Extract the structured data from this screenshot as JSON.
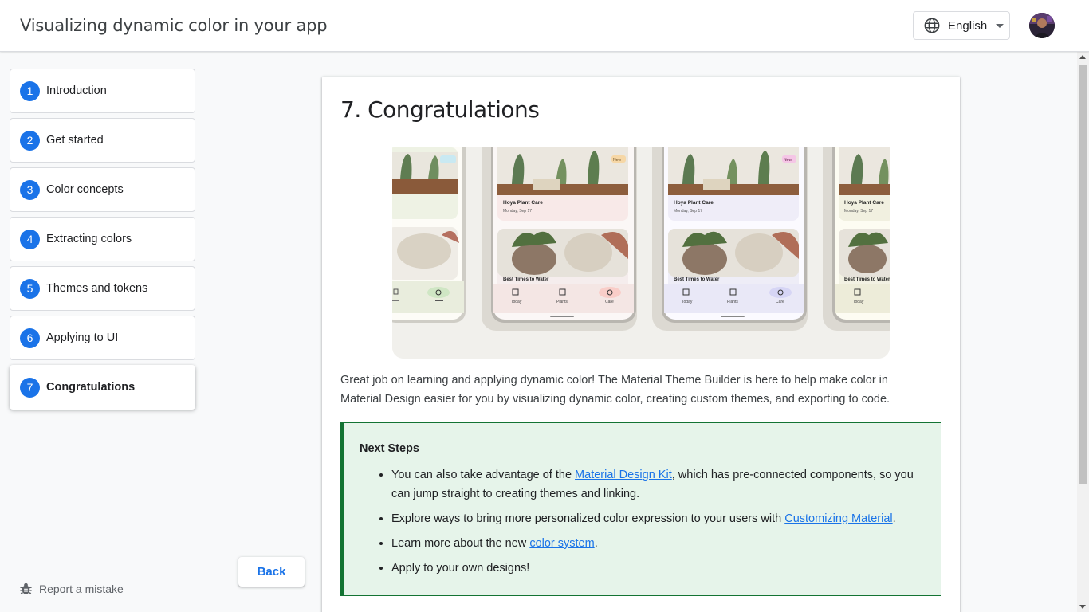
{
  "header": {
    "title": "Visualizing dynamic color in your app",
    "language": "English"
  },
  "steps": [
    {
      "num": "1",
      "label": "Introduction"
    },
    {
      "num": "2",
      "label": "Get started"
    },
    {
      "num": "3",
      "label": "Color concepts"
    },
    {
      "num": "4",
      "label": "Extracting colors"
    },
    {
      "num": "5",
      "label": "Themes and tokens"
    },
    {
      "num": "6",
      "label": "Applying to UI"
    },
    {
      "num": "7",
      "label": "Congratulations"
    }
  ],
  "active_step": 7,
  "nav": {
    "back_label": "Back",
    "report_label": "Report a mistake"
  },
  "content": {
    "heading": "7. Congratulations",
    "hero": {
      "card_title": "Hoya Plant Care",
      "card_date": "Monday, Sep 17",
      "section_title": "Best Times to Water",
      "badge": "New",
      "nav_items": [
        "Today",
        "Plants",
        "Care"
      ]
    },
    "intro": "Great job on learning and applying dynamic color! The Material Theme Builder is here to help make color in Material Design easier for you by visualizing dynamic color, creating custom themes, and exporting to code.",
    "next_steps": {
      "title": "Next Steps",
      "item1_before": "You can also take advantage of the ",
      "item1_link": "Material Design Kit",
      "item1_after": ", which has pre-connected components, so you can jump straight to creating themes and linking.",
      "item2_before": "Explore ways to bring more personalized color expression to your users with ",
      "item2_link": "Customizing Material",
      "item2_after": ".",
      "item3_before": "Learn more about the new ",
      "item3_link": "color system",
      "item3_after": ".",
      "item4": "Apply to your own designs!"
    }
  },
  "colors": {
    "accent": "#1a73e8",
    "callout_bg": "#e6f4ea",
    "callout_border": "#137333"
  }
}
